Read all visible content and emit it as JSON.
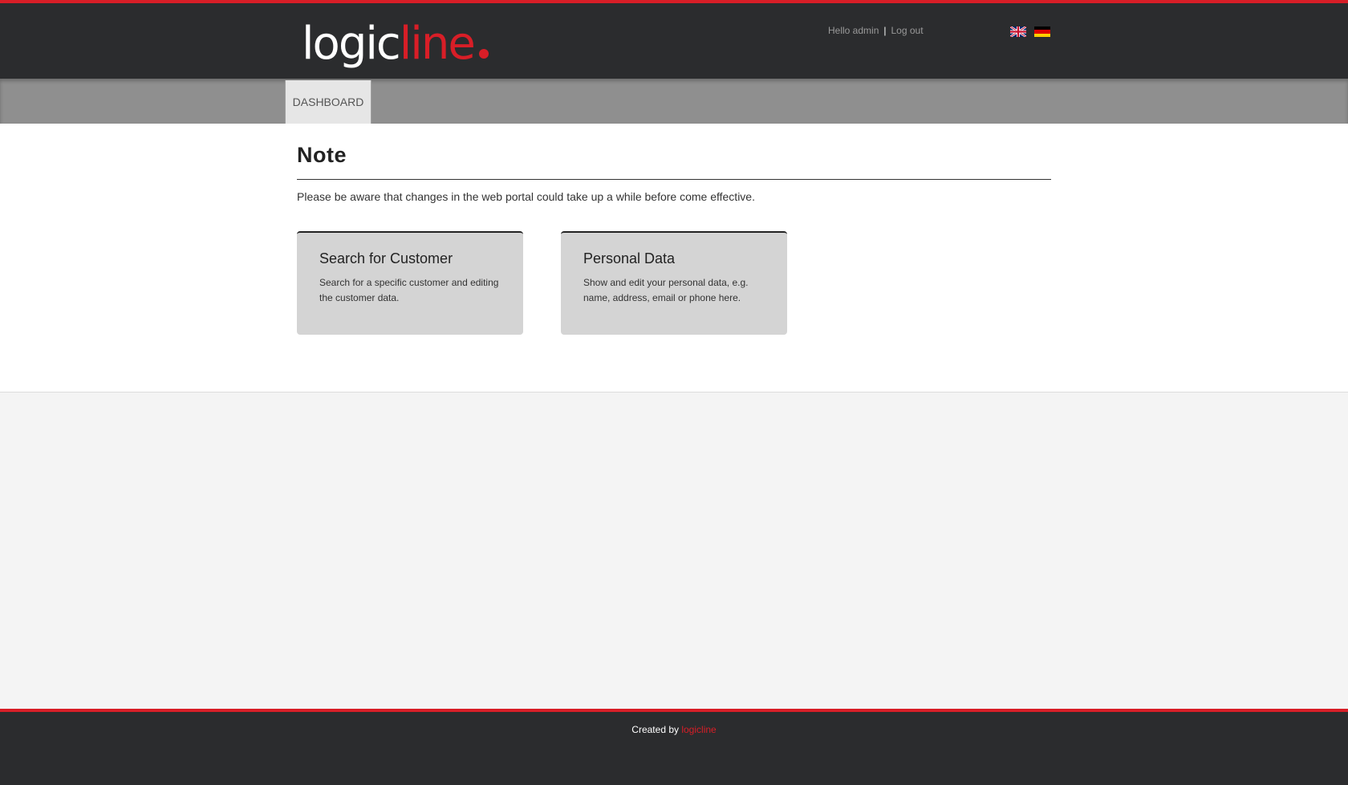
{
  "header": {
    "logo": {
      "part_white": "logic",
      "part_red": "line"
    },
    "greeting": "Hello admin",
    "separator": "|",
    "logout_label": "Log out",
    "languages": [
      "english-flag-icon",
      "german-flag-icon"
    ]
  },
  "nav": {
    "tabs": [
      {
        "label": "DASHBOARD",
        "active": true
      }
    ]
  },
  "main": {
    "title": "Note",
    "note_text": "Please be aware that changes in the web portal could take up a while before come effective.",
    "cards": [
      {
        "title": "Search for Customer",
        "description": "Search for a specific customer and editing the customer data."
      },
      {
        "title": "Personal Data",
        "description": "Show and edit your personal data, e.g. name, address, email or phone here."
      }
    ]
  },
  "footer": {
    "created_by": "Created by",
    "brand": "logicline"
  },
  "colors": {
    "accent_red": "#d81e27",
    "header_bg": "#2b2c2e",
    "nav_bg": "#8f8f8f",
    "card_bg": "#d4d4d4"
  }
}
